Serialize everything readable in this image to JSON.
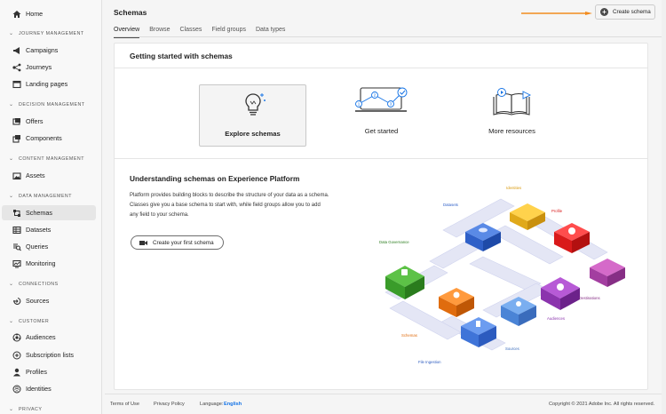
{
  "sidebar": {
    "top": [
      {
        "label": "Home",
        "icon": "home-icon"
      }
    ],
    "sections": [
      {
        "title": "JOURNEY MANAGEMENT",
        "items": [
          {
            "label": "Campaigns",
            "icon": "megaphone-icon"
          },
          {
            "label": "Journeys",
            "icon": "journey-icon"
          },
          {
            "label": "Landing pages",
            "icon": "page-icon"
          }
        ]
      },
      {
        "title": "DECISION MANAGEMENT",
        "items": [
          {
            "label": "Offers",
            "icon": "offers-icon"
          },
          {
            "label": "Components",
            "icon": "components-icon"
          }
        ]
      },
      {
        "title": "CONTENT MANAGEMENT",
        "items": [
          {
            "label": "Assets",
            "icon": "assets-icon"
          }
        ]
      },
      {
        "title": "DATA MANAGEMENT",
        "items": [
          {
            "label": "Schemas",
            "icon": "schema-icon",
            "active": true
          },
          {
            "label": "Datasets",
            "icon": "datasets-icon"
          },
          {
            "label": "Queries",
            "icon": "queries-icon"
          },
          {
            "label": "Monitoring",
            "icon": "monitoring-icon"
          }
        ]
      },
      {
        "title": "CONNECTIONS",
        "items": [
          {
            "label": "Sources",
            "icon": "sources-icon"
          }
        ]
      },
      {
        "title": "CUSTOMER",
        "items": [
          {
            "label": "Audiences",
            "icon": "audiences-icon"
          },
          {
            "label": "Subscription lists",
            "icon": "subscription-icon"
          },
          {
            "label": "Profiles",
            "icon": "profile-icon"
          },
          {
            "label": "Identities",
            "icon": "identities-icon"
          }
        ]
      },
      {
        "title": "PRIVACY",
        "items": []
      }
    ]
  },
  "header": {
    "title": "Schemas",
    "tabs": [
      "Overview",
      "Browse",
      "Classes",
      "Field groups",
      "Data types"
    ],
    "active_tab": "Overview",
    "create_label": "Create schema"
  },
  "card": {
    "title": "Getting started with schemas",
    "tiles": [
      {
        "label": "Explore schemas",
        "icon": "lightbulb-icon",
        "selected": true
      },
      {
        "label": "Get started",
        "icon": "laptop-steps-icon"
      },
      {
        "label": "More resources",
        "icon": "book-icon"
      }
    ],
    "subtitle": "Understanding schemas on Experience Platform",
    "description": "Platform provides building blocks to describe the structure of your data as a schema. Classes give you a base schema to start with, while field groups allow you to add any field to your schema.",
    "cta_label": "Create your first schema",
    "illustration_labels": {
      "identities": "Identities",
      "datasets": "Datasets",
      "profile": "Profile",
      "data_governance": "Data Governance",
      "destinations": "Destinations",
      "audiences": "Audiences",
      "schemas": "Schemas",
      "sources": "Sources",
      "file_ingestion": "File Ingestion"
    }
  },
  "footer": {
    "terms": "Terms of Use",
    "privacy": "Privacy Policy",
    "language_label": "Language:",
    "language_value": "English",
    "copyright": "Copyright © 2021 Adobe Inc. All rights reserved."
  },
  "colors": {
    "accent_arrow": "#f28b1e",
    "link": "#1473e6"
  }
}
